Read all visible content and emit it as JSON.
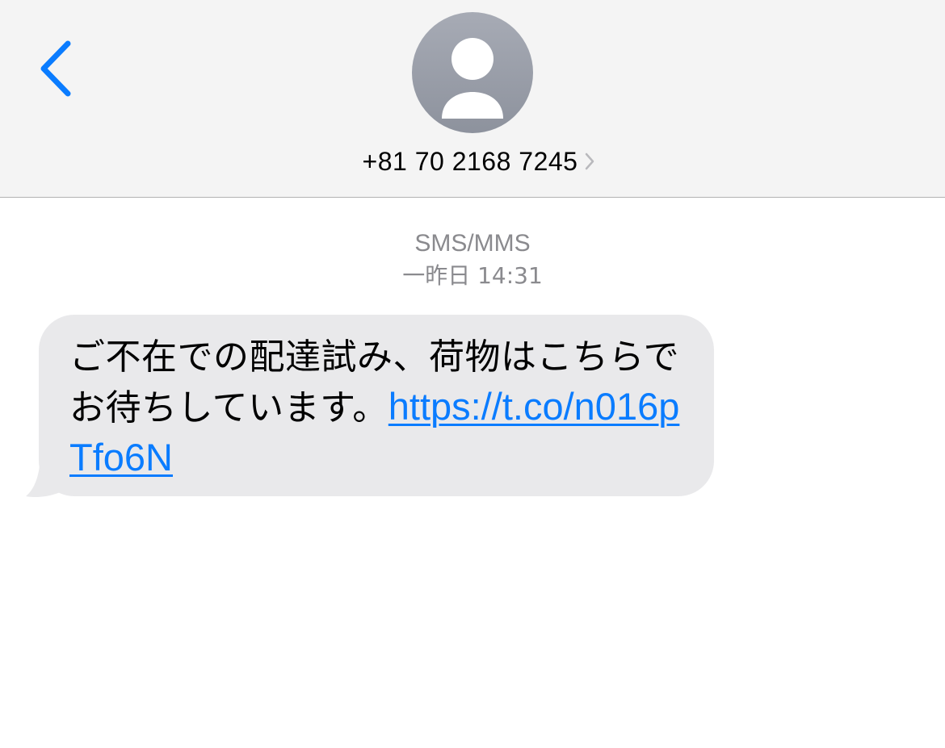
{
  "header": {
    "back_icon": "chevron-left-icon",
    "avatar_icon": "person-silhouette-icon",
    "contact_name": "+81 70 2168 7245",
    "contact_chevron_icon": "chevron-right-icon"
  },
  "conversation": {
    "service": "SMS/MMS",
    "timestamp": "一昨日 14:31"
  },
  "message": {
    "text": "ご不在での配達試み、荷物はこちらでお待ちしています。",
    "link": "https://t.co/n016pTfo6N"
  },
  "colors": {
    "accent": "#0a7cff",
    "bubble": "#e9e9eb",
    "header_bg": "#f4f4f4",
    "meta_text": "#8a8a8e"
  }
}
